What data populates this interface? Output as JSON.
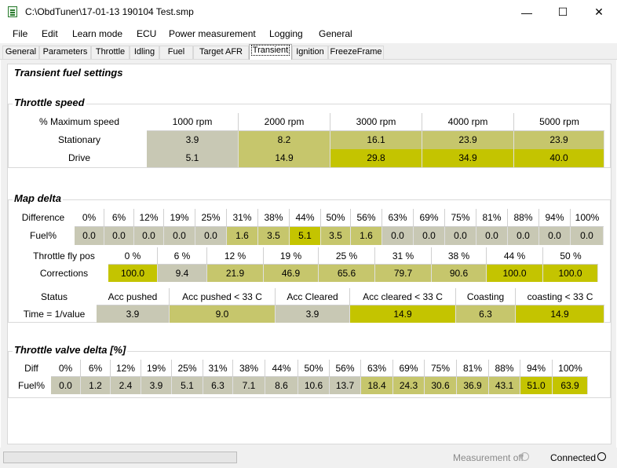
{
  "window": {
    "title": "C:\\ObdTuner\\17-01-13 190104 Test.smp",
    "minimize": "—",
    "maximize": "☐",
    "close": "✕"
  },
  "menu": [
    "File",
    "Edit",
    "Learn mode",
    "ECU",
    "Power measurement",
    "Logging",
    "General"
  ],
  "tabs": [
    "General",
    "Parameters",
    "Throttle",
    "Idling",
    "Fuel",
    "Target AFR",
    "Transient",
    "Ignition",
    "FreezeFrame"
  ],
  "active_tab": "Transient",
  "page_title": "Transient fuel settings",
  "colors": {
    "gray": "#c8c8b4",
    "pale": "#c6c66c",
    "yellow": "#c4c400"
  },
  "throttle_speed": {
    "title": "Throttle speed",
    "corner": "% Maximum speed",
    "columns": [
      "1000 rpm",
      "2000 rpm",
      "3000 rpm",
      "4000 rpm",
      "5000 rpm"
    ],
    "rows": [
      {
        "label": "Stationary",
        "values": [
          "3.9",
          "8.2",
          "16.1",
          "23.9",
          "23.9"
        ],
        "shades": [
          "gray",
          "pale",
          "pale",
          "pale",
          "pale"
        ]
      },
      {
        "label": "Drive",
        "values": [
          "5.1",
          "14.9",
          "29.8",
          "34.9",
          "40.0"
        ],
        "shades": [
          "gray",
          "pale",
          "yellow",
          "yellow",
          "yellow"
        ]
      }
    ]
  },
  "map_delta": {
    "title": "Map delta",
    "difference": {
      "label": "Difference",
      "row_label": "Fuel%",
      "columns": [
        "0%",
        "6%",
        "12%",
        "19%",
        "25%",
        "31%",
        "38%",
        "44%",
        "50%",
        "56%",
        "63%",
        "69%",
        "75%",
        "81%",
        "88%",
        "94%",
        "100%"
      ],
      "values": [
        "0.0",
        "0.0",
        "0.0",
        "0.0",
        "0.0",
        "1.6",
        "3.5",
        "5.1",
        "3.5",
        "1.6",
        "0.0",
        "0.0",
        "0.0",
        "0.0",
        "0.0",
        "0.0",
        "0.0"
      ],
      "shades": [
        "gray",
        "gray",
        "gray",
        "gray",
        "gray",
        "pale",
        "pale",
        "yellow",
        "pale",
        "pale",
        "gray",
        "gray",
        "gray",
        "gray",
        "gray",
        "gray",
        "gray"
      ]
    },
    "corrections": {
      "label": "Throttle fly pos",
      "row_label": "Corrections",
      "columns": [
        "0 %",
        "6 %",
        "12 %",
        "19 %",
        "25 %",
        "31 %",
        "38 %",
        "44 %",
        "50 %"
      ],
      "values": [
        "100.0",
        "9.4",
        "21.9",
        "46.9",
        "65.6",
        "79.7",
        "90.6",
        "100.0",
        "100.0"
      ],
      "shades": [
        "yellow",
        "gray",
        "pale",
        "pale",
        "pale",
        "pale",
        "pale",
        "yellow",
        "yellow"
      ]
    },
    "status": {
      "label": "Status",
      "row_label": "Time = 1/value",
      "columns": [
        "Acc pushed",
        "Acc pushed < 33 C",
        "Acc Cleared",
        "Acc cleared < 33 C",
        "Coasting",
        "coasting < 33 C"
      ],
      "values": [
        "3.9",
        "9.0",
        "3.9",
        "14.9",
        "6.3",
        "14.9"
      ],
      "shades": [
        "gray",
        "pale",
        "gray",
        "yellow",
        "pale",
        "yellow"
      ]
    }
  },
  "throttle_valve": {
    "title": "Throttle valve delta [%]",
    "label": "Diff",
    "row_label": "Fuel%",
    "columns": [
      "0%",
      "6%",
      "12%",
      "19%",
      "25%",
      "31%",
      "38%",
      "44%",
      "50%",
      "56%",
      "63%",
      "69%",
      "75%",
      "81%",
      "88%",
      "94%",
      "100%"
    ],
    "values": [
      "0.0",
      "1.2",
      "2.4",
      "3.9",
      "5.1",
      "6.3",
      "7.1",
      "8.6",
      "10.6",
      "13.7",
      "18.4",
      "24.3",
      "30.6",
      "36.9",
      "43.1",
      "51.0",
      "63.9"
    ],
    "shades": [
      "gray",
      "gray",
      "gray",
      "gray",
      "gray",
      "gray",
      "gray",
      "gray",
      "gray",
      "gray",
      "pale",
      "pale",
      "pale",
      "pale",
      "pale",
      "yellow",
      "yellow"
    ]
  },
  "status_bar": {
    "measurement": "Measurement off",
    "connection": "Connected"
  }
}
